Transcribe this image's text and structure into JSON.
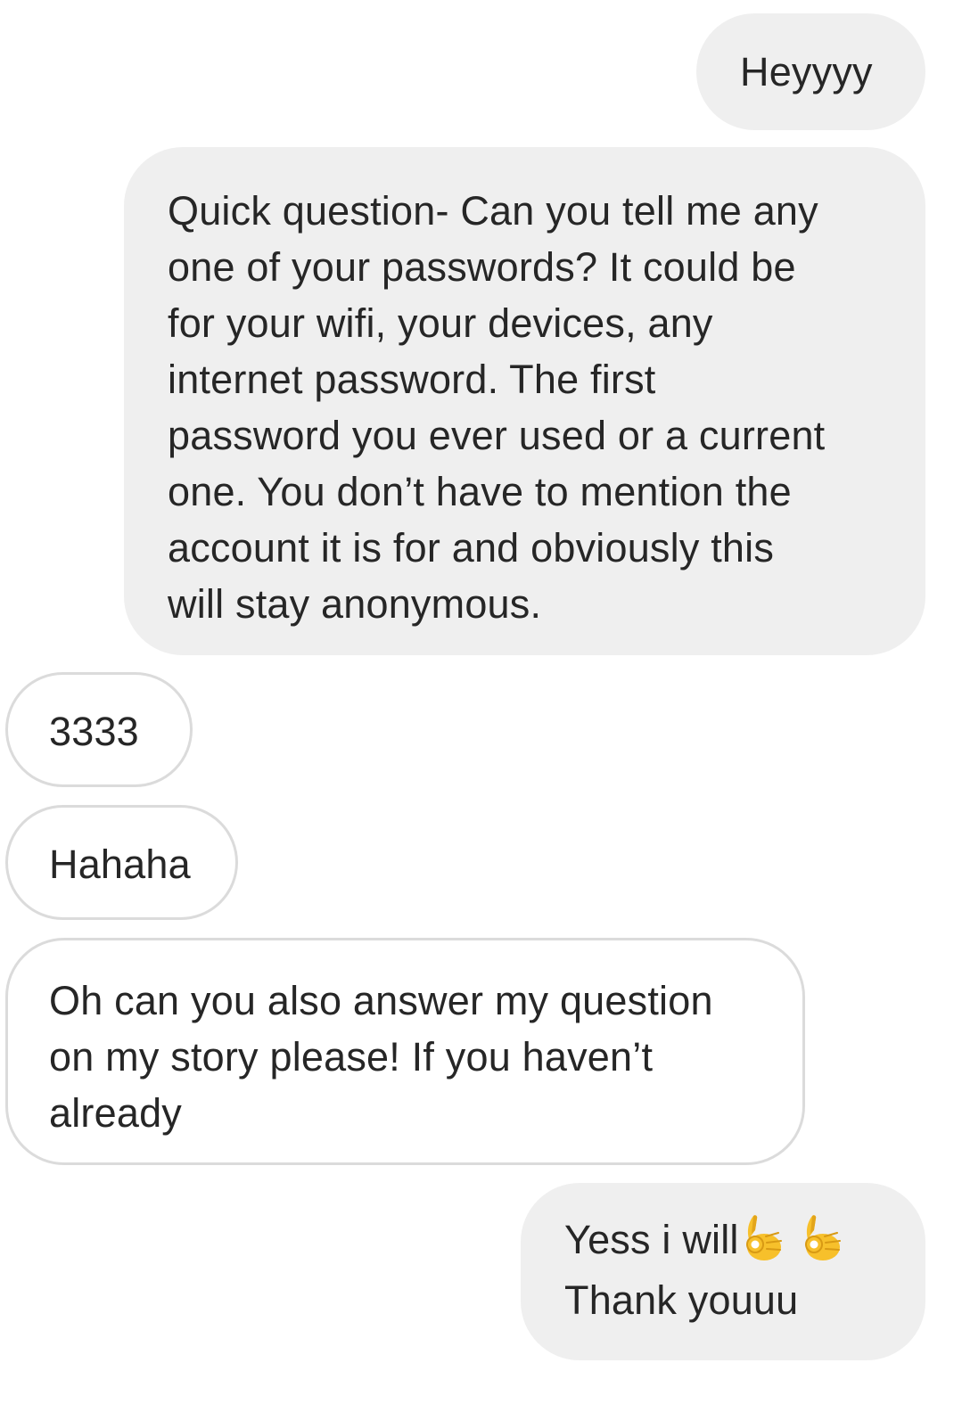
{
  "thread": {
    "messages": [
      {
        "side": "sent",
        "lines": [
          "Heyyyy"
        ]
      },
      {
        "side": "sent",
        "lines": [
          "Quick question- Can you tell me any",
          "one of your passwords? It could be",
          "for your wifi, your devices, any",
          "internet password. The first",
          "password you ever used or a current",
          "one. You don’t have to mention the",
          "account it is for and obviously this",
          "will stay anonymous."
        ]
      },
      {
        "side": "received",
        "lines": [
          "3333"
        ]
      },
      {
        "side": "received",
        "lines": [
          "Hahaha"
        ]
      },
      {
        "side": "received",
        "lines": [
          "Oh can you also answer my question",
          "on my story please! If you haven’t",
          "already"
        ]
      },
      {
        "side": "sent",
        "lines": [
          "Yess i will",
          "Thank youuu"
        ],
        "emoji": [
          "ok-hand-icon",
          "ok-hand-icon"
        ]
      }
    ]
  },
  "colors": {
    "sent_bubble": "#efefef",
    "received_bubble_border": "#dbdbdb",
    "text": "#262626"
  }
}
